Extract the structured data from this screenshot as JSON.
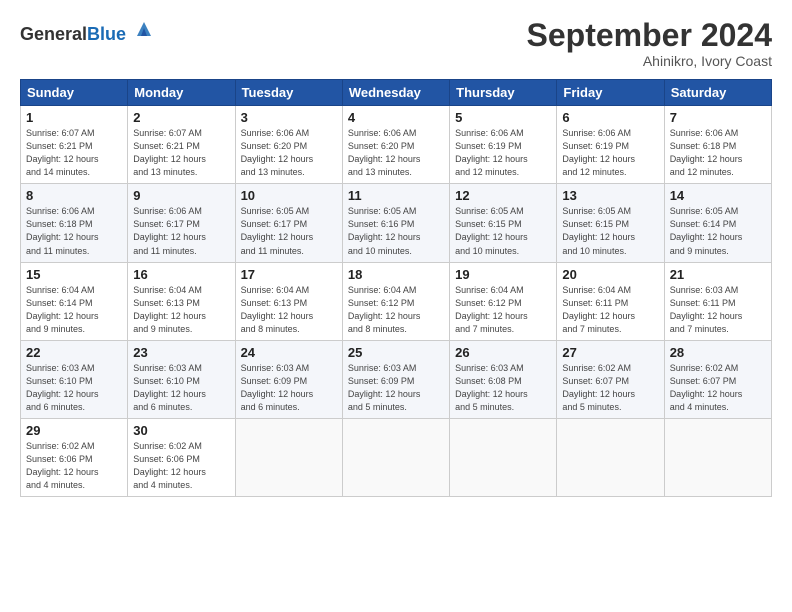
{
  "header": {
    "logo_general": "General",
    "logo_blue": "Blue",
    "month": "September 2024",
    "location": "Ahinikro, Ivory Coast"
  },
  "weekdays": [
    "Sunday",
    "Monday",
    "Tuesday",
    "Wednesday",
    "Thursday",
    "Friday",
    "Saturday"
  ],
  "weeks": [
    [
      {
        "day": "1",
        "info": "Sunrise: 6:07 AM\nSunset: 6:21 PM\nDaylight: 12 hours\nand 14 minutes."
      },
      {
        "day": "2",
        "info": "Sunrise: 6:07 AM\nSunset: 6:21 PM\nDaylight: 12 hours\nand 13 minutes."
      },
      {
        "day": "3",
        "info": "Sunrise: 6:06 AM\nSunset: 6:20 PM\nDaylight: 12 hours\nand 13 minutes."
      },
      {
        "day": "4",
        "info": "Sunrise: 6:06 AM\nSunset: 6:20 PM\nDaylight: 12 hours\nand 13 minutes."
      },
      {
        "day": "5",
        "info": "Sunrise: 6:06 AM\nSunset: 6:19 PM\nDaylight: 12 hours\nand 12 minutes."
      },
      {
        "day": "6",
        "info": "Sunrise: 6:06 AM\nSunset: 6:19 PM\nDaylight: 12 hours\nand 12 minutes."
      },
      {
        "day": "7",
        "info": "Sunrise: 6:06 AM\nSunset: 6:18 PM\nDaylight: 12 hours\nand 12 minutes."
      }
    ],
    [
      {
        "day": "8",
        "info": "Sunrise: 6:06 AM\nSunset: 6:18 PM\nDaylight: 12 hours\nand 11 minutes."
      },
      {
        "day": "9",
        "info": "Sunrise: 6:06 AM\nSunset: 6:17 PM\nDaylight: 12 hours\nand 11 minutes."
      },
      {
        "day": "10",
        "info": "Sunrise: 6:05 AM\nSunset: 6:17 PM\nDaylight: 12 hours\nand 11 minutes."
      },
      {
        "day": "11",
        "info": "Sunrise: 6:05 AM\nSunset: 6:16 PM\nDaylight: 12 hours\nand 10 minutes."
      },
      {
        "day": "12",
        "info": "Sunrise: 6:05 AM\nSunset: 6:15 PM\nDaylight: 12 hours\nand 10 minutes."
      },
      {
        "day": "13",
        "info": "Sunrise: 6:05 AM\nSunset: 6:15 PM\nDaylight: 12 hours\nand 10 minutes."
      },
      {
        "day": "14",
        "info": "Sunrise: 6:05 AM\nSunset: 6:14 PM\nDaylight: 12 hours\nand 9 minutes."
      }
    ],
    [
      {
        "day": "15",
        "info": "Sunrise: 6:04 AM\nSunset: 6:14 PM\nDaylight: 12 hours\nand 9 minutes."
      },
      {
        "day": "16",
        "info": "Sunrise: 6:04 AM\nSunset: 6:13 PM\nDaylight: 12 hours\nand 9 minutes."
      },
      {
        "day": "17",
        "info": "Sunrise: 6:04 AM\nSunset: 6:13 PM\nDaylight: 12 hours\nand 8 minutes."
      },
      {
        "day": "18",
        "info": "Sunrise: 6:04 AM\nSunset: 6:12 PM\nDaylight: 12 hours\nand 8 minutes."
      },
      {
        "day": "19",
        "info": "Sunrise: 6:04 AM\nSunset: 6:12 PM\nDaylight: 12 hours\nand 7 minutes."
      },
      {
        "day": "20",
        "info": "Sunrise: 6:04 AM\nSunset: 6:11 PM\nDaylight: 12 hours\nand 7 minutes."
      },
      {
        "day": "21",
        "info": "Sunrise: 6:03 AM\nSunset: 6:11 PM\nDaylight: 12 hours\nand 7 minutes."
      }
    ],
    [
      {
        "day": "22",
        "info": "Sunrise: 6:03 AM\nSunset: 6:10 PM\nDaylight: 12 hours\nand 6 minutes."
      },
      {
        "day": "23",
        "info": "Sunrise: 6:03 AM\nSunset: 6:10 PM\nDaylight: 12 hours\nand 6 minutes."
      },
      {
        "day": "24",
        "info": "Sunrise: 6:03 AM\nSunset: 6:09 PM\nDaylight: 12 hours\nand 6 minutes."
      },
      {
        "day": "25",
        "info": "Sunrise: 6:03 AM\nSunset: 6:09 PM\nDaylight: 12 hours\nand 5 minutes."
      },
      {
        "day": "26",
        "info": "Sunrise: 6:03 AM\nSunset: 6:08 PM\nDaylight: 12 hours\nand 5 minutes."
      },
      {
        "day": "27",
        "info": "Sunrise: 6:02 AM\nSunset: 6:07 PM\nDaylight: 12 hours\nand 5 minutes."
      },
      {
        "day": "28",
        "info": "Sunrise: 6:02 AM\nSunset: 6:07 PM\nDaylight: 12 hours\nand 4 minutes."
      }
    ],
    [
      {
        "day": "29",
        "info": "Sunrise: 6:02 AM\nSunset: 6:06 PM\nDaylight: 12 hours\nand 4 minutes."
      },
      {
        "day": "30",
        "info": "Sunrise: 6:02 AM\nSunset: 6:06 PM\nDaylight: 12 hours\nand 4 minutes."
      },
      {
        "day": "",
        "info": ""
      },
      {
        "day": "",
        "info": ""
      },
      {
        "day": "",
        "info": ""
      },
      {
        "day": "",
        "info": ""
      },
      {
        "day": "",
        "info": ""
      }
    ]
  ]
}
